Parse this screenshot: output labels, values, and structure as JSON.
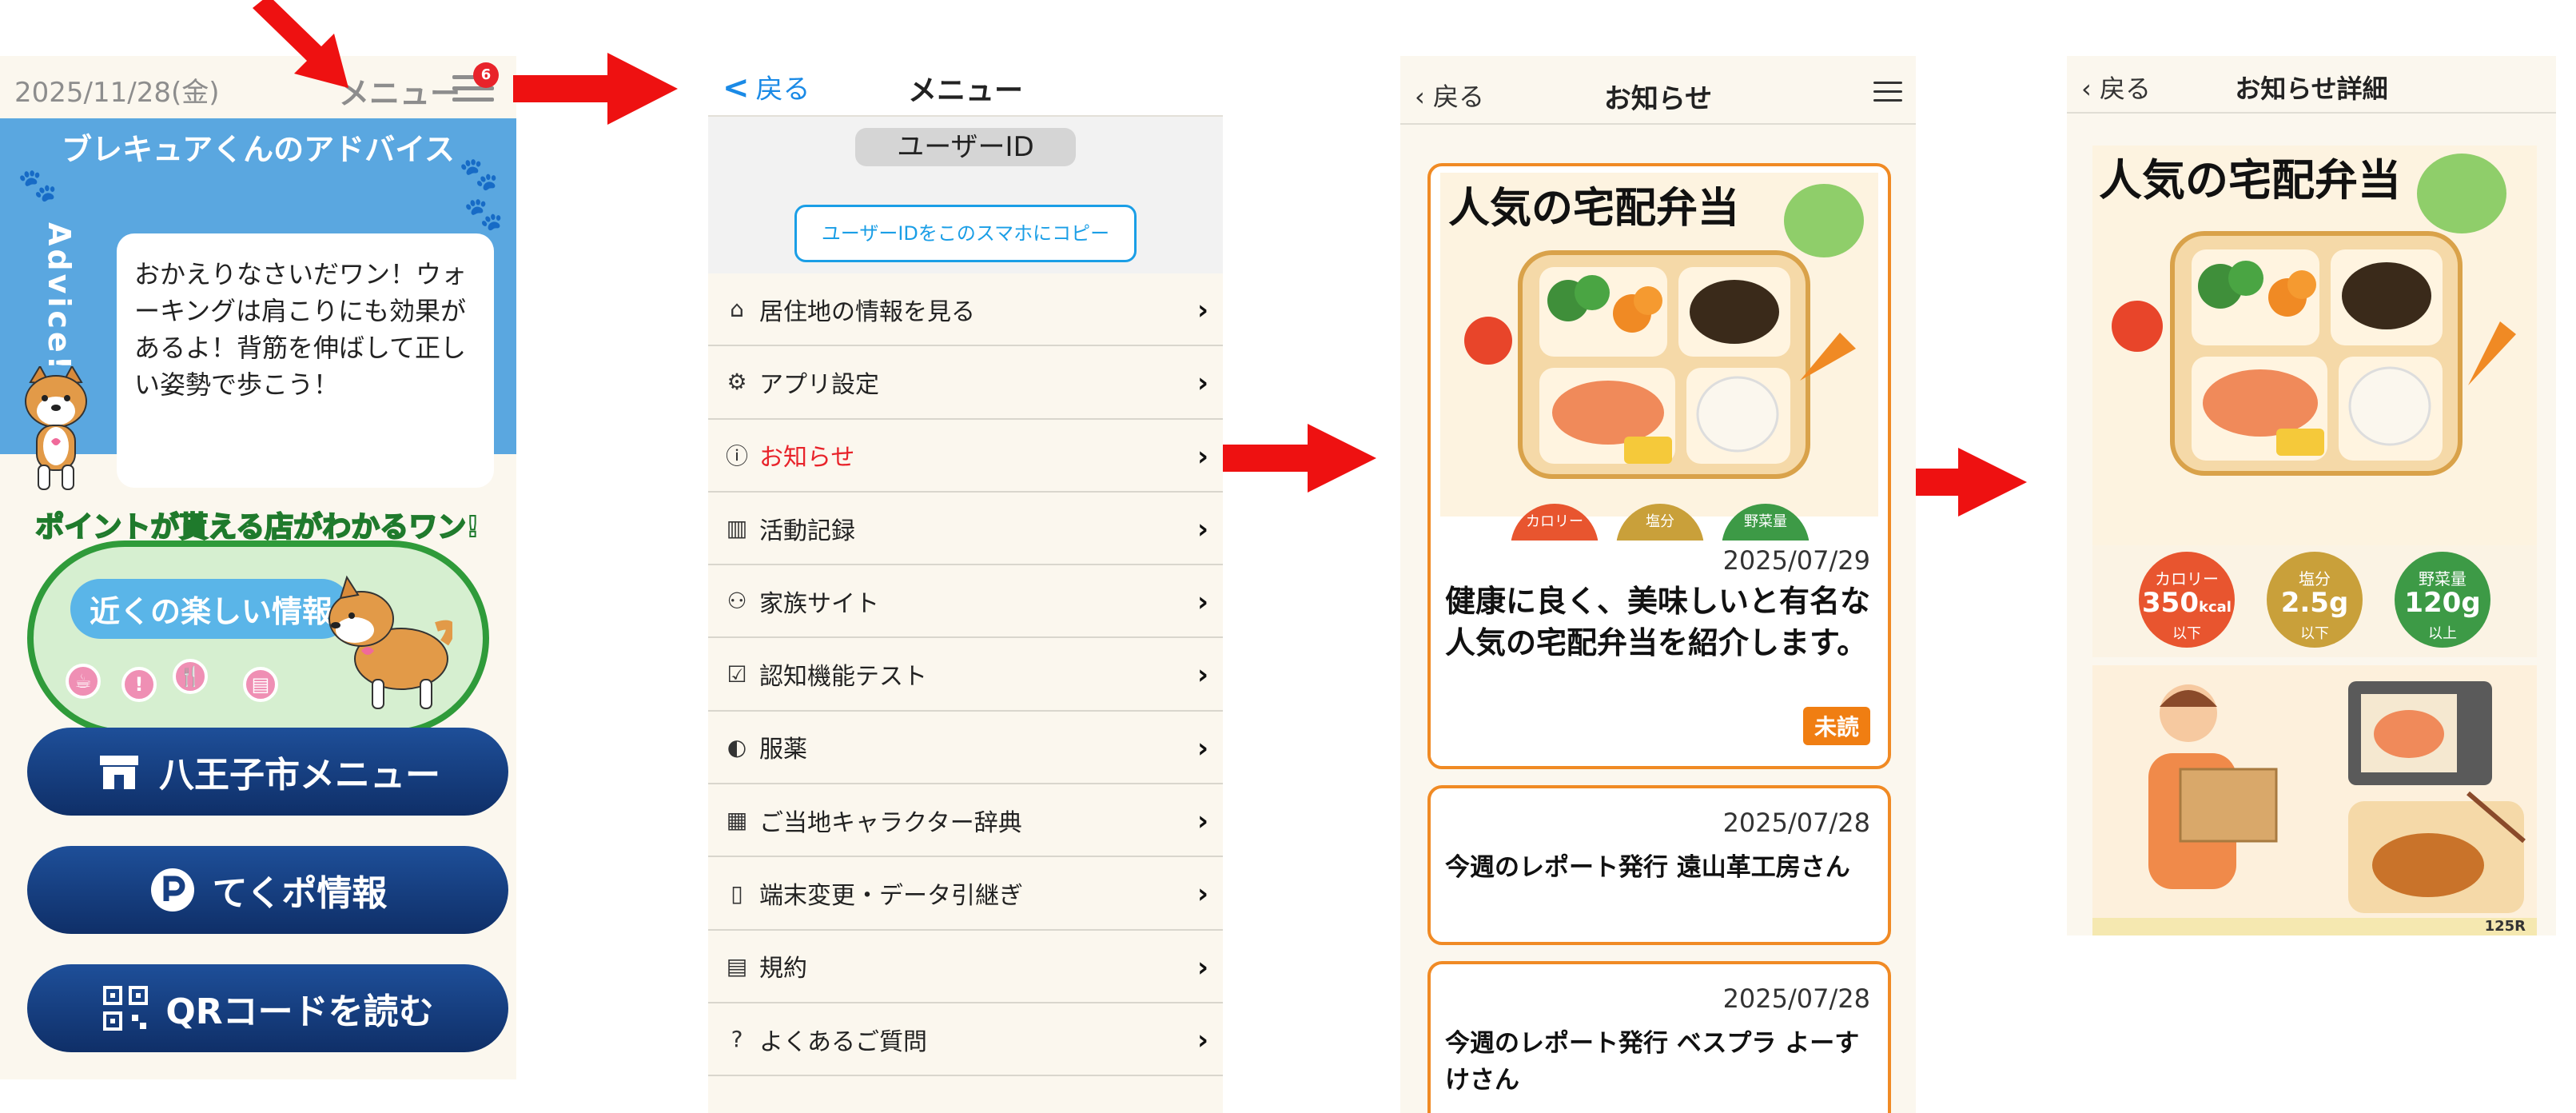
{
  "home": {
    "date": "2025/11/28(金)",
    "menu_label": "メニュー",
    "badge_count": "6",
    "advice_title": "ブレキュアくんのアドバイス",
    "advice_vertical": "Advice!",
    "advice_text": "おかえりなさいだワン！ウォーキングは肩こりにも効果があるよ！背筋を伸ばして正しい姿勢で歩こう！",
    "promo_caption": "ポイントが貰える店がわかるワン!",
    "promo_label": "近くの楽しい情報",
    "buttons": [
      "八王子市メニュー",
      "てくポ情報",
      "QRコードを読む"
    ]
  },
  "menu": {
    "back_label": "戻る",
    "title": "メニュー",
    "user_id_label": "ユーザーID",
    "copy_button": "ユーザーIDをこのスマホにコピー",
    "items": [
      {
        "label": "居住地の情報を見る",
        "icon": "house-icon"
      },
      {
        "label": "アプリ設定",
        "icon": "gear-icon"
      },
      {
        "label": "お知らせ",
        "icon": "info-icon"
      },
      {
        "label": "活動記録",
        "icon": "chart-icon"
      },
      {
        "label": "家族サイト",
        "icon": "family-icon"
      },
      {
        "label": "認知機能テスト",
        "icon": "clipboard-icon"
      },
      {
        "label": "服薬",
        "icon": "pill-icon"
      },
      {
        "label": "ご当地キャラクター辞典",
        "icon": "book-icon"
      },
      {
        "label": "端末変更・データ引継ぎ",
        "icon": "phone-transfer-icon"
      },
      {
        "label": "規約",
        "icon": "document-icon"
      },
      {
        "label": "よくあるご質問",
        "icon": "question-icon"
      }
    ],
    "active_index": 2
  },
  "notices": {
    "back_label": "戻る",
    "title": "お知らせ",
    "image_title": "人気の宅配弁当",
    "cards": [
      {
        "date": "2025/07/29",
        "text": "健康に良く、美味しいと有名な人気の宅配弁当を紹介します。",
        "status": "未読"
      },
      {
        "date": "2025/07/28",
        "text": "今週のレポート発行 遠山革工房さん"
      },
      {
        "date": "2025/07/28",
        "text": "今週のレポート発行 ベスプラ よーすけさん"
      }
    ],
    "mini_labels": [
      "カロリー",
      "塩分",
      "野菜量"
    ]
  },
  "detail": {
    "back_label": "戻る",
    "title": "お知らせ詳細",
    "image_title": "人気の宅配弁当",
    "nutrition": [
      {
        "label": "カロリー",
        "value": "350",
        "unit": "kcal",
        "cond": "以下",
        "color": "#e8552f"
      },
      {
        "label": "塩分",
        "value": "2.5",
        "unit": "g",
        "cond": "以下",
        "color": "#c9a03a"
      },
      {
        "label": "野菜量",
        "value": "120",
        "unit": "g",
        "cond": "以上",
        "color": "#3d9a46"
      }
    ],
    "strip_text": "125R"
  },
  "colors": {
    "accent_red": "#e8232a",
    "navy": "#153a7a",
    "orange": "#f08a24",
    "sky": "#5aa7e0",
    "ios_blue": "#1a8ae6"
  }
}
